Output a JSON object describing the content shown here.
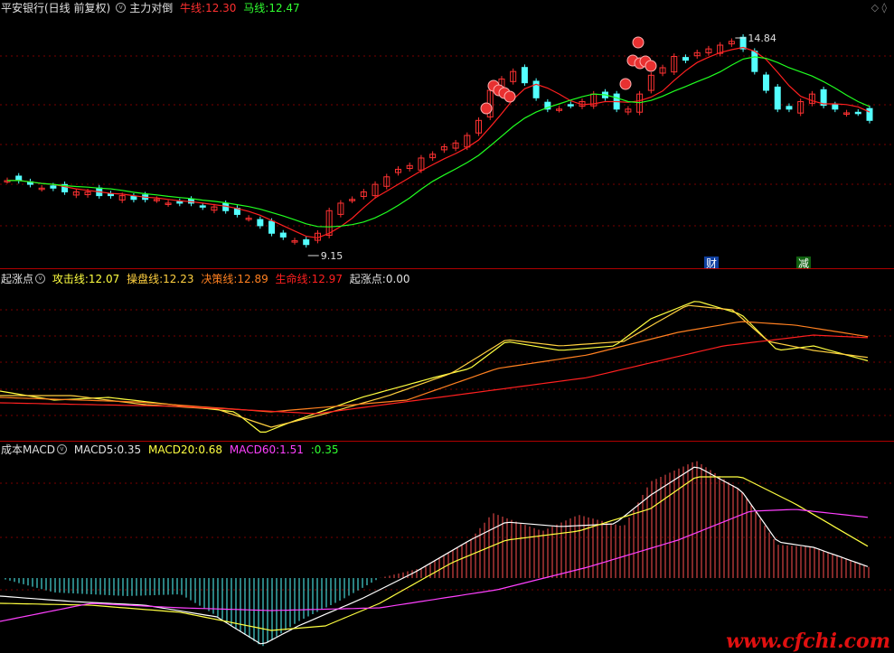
{
  "header1": {
    "title": "平安银行(日线 前复权)",
    "indicator": "主力对倒",
    "niu_label": "牛线:",
    "niu_value": "12.30",
    "ma_label": "马线:",
    "ma_value": "12.47"
  },
  "header2": {
    "name": "起涨点",
    "gongji_label": "攻击线:",
    "gongji_value": "12.07",
    "caopan_label": "操盘线:",
    "caopan_value": "12.23",
    "juece_label": "决策线:",
    "juece_value": "12.89",
    "shengming_label": "生命线:",
    "shengming_value": "12.97",
    "qizhang_label": "起涨点:",
    "qizhang_value": "0.00"
  },
  "header3": {
    "name": "成本MACD",
    "macd5_label": "MACD5:",
    "macd5_value": "0.35",
    "macd20_label": "MACD20:",
    "macd20_value": "0.68",
    "macd60_label": "MACD60:",
    "macd60_value": "1.51",
    "extra_label": ":",
    "extra_value": "0.35"
  },
  "corner_icons": "◇ ◊",
  "annotations": {
    "high": "14.84",
    "low": "9.15",
    "cai": "财",
    "jian": "减"
  },
  "watermark": "www.cfchi.com",
  "colors": {
    "background": "#000000",
    "up": "#ff3232",
    "down": "#54ffff",
    "niu": "#ff2020",
    "ma": "#20ff20",
    "yellow": "#ffff40",
    "magenta": "#ff40ff",
    "separator": "#b00000"
  },
  "chart_data": [
    {
      "type": "candlestick",
      "title": "平安银行(日线 前复权)",
      "series": [
        {
          "name": "牛线",
          "last": 12.3
        },
        {
          "name": "马线",
          "last": 12.47
        }
      ],
      "annotated_high": 14.84,
      "annotated_low": 9.15,
      "close_path": [
        11.0,
        11.0,
        10.9,
        10.8,
        10.8,
        10.7,
        10.7,
        10.7,
        10.6,
        10.6,
        10.6,
        10.5,
        10.5,
        10.5,
        10.4,
        10.4,
        10.4,
        10.3,
        10.3,
        10.2,
        10.1,
        10.0,
        9.8,
        9.6,
        9.5,
        9.4,
        9.3,
        9.6,
        10.2,
        10.4,
        10.5,
        10.7,
        10.9,
        11.1,
        11.3,
        11.4,
        11.6,
        11.7,
        11.9,
        12.0,
        12.2,
        12.6,
        13.4,
        13.7,
        13.9,
        13.6,
        13.2,
        12.9,
        12.9,
        13.0,
        13.1,
        13.3,
        13.2,
        12.9,
        12.9,
        13.3,
        13.8,
        14.0,
        14.3,
        14.2,
        14.4,
        14.5,
        14.6,
        14.7,
        14.5,
        13.9,
        13.4,
        12.9,
        12.9,
        13.1,
        13.3,
        13.0,
        12.9,
        12.8,
        12.8,
        12.6
      ]
    },
    {
      "type": "line",
      "title": "起涨点",
      "series": [
        {
          "name": "攻击线",
          "last": 12.07
        },
        {
          "name": "操盘线",
          "last": 12.23
        },
        {
          "name": "决策线",
          "last": 12.89
        },
        {
          "name": "生命线",
          "last": 12.97
        },
        {
          "name": "起涨点",
          "last": 0.0
        }
      ]
    },
    {
      "type": "bar",
      "title": "成本MACD",
      "series": [
        {
          "name": "MACD5",
          "last": 0.35
        },
        {
          "name": "MACD20",
          "last": 0.68
        },
        {
          "name": "MACD60",
          "last": 1.51
        },
        {
          "name": "",
          "last": 0.35
        }
      ]
    }
  ]
}
